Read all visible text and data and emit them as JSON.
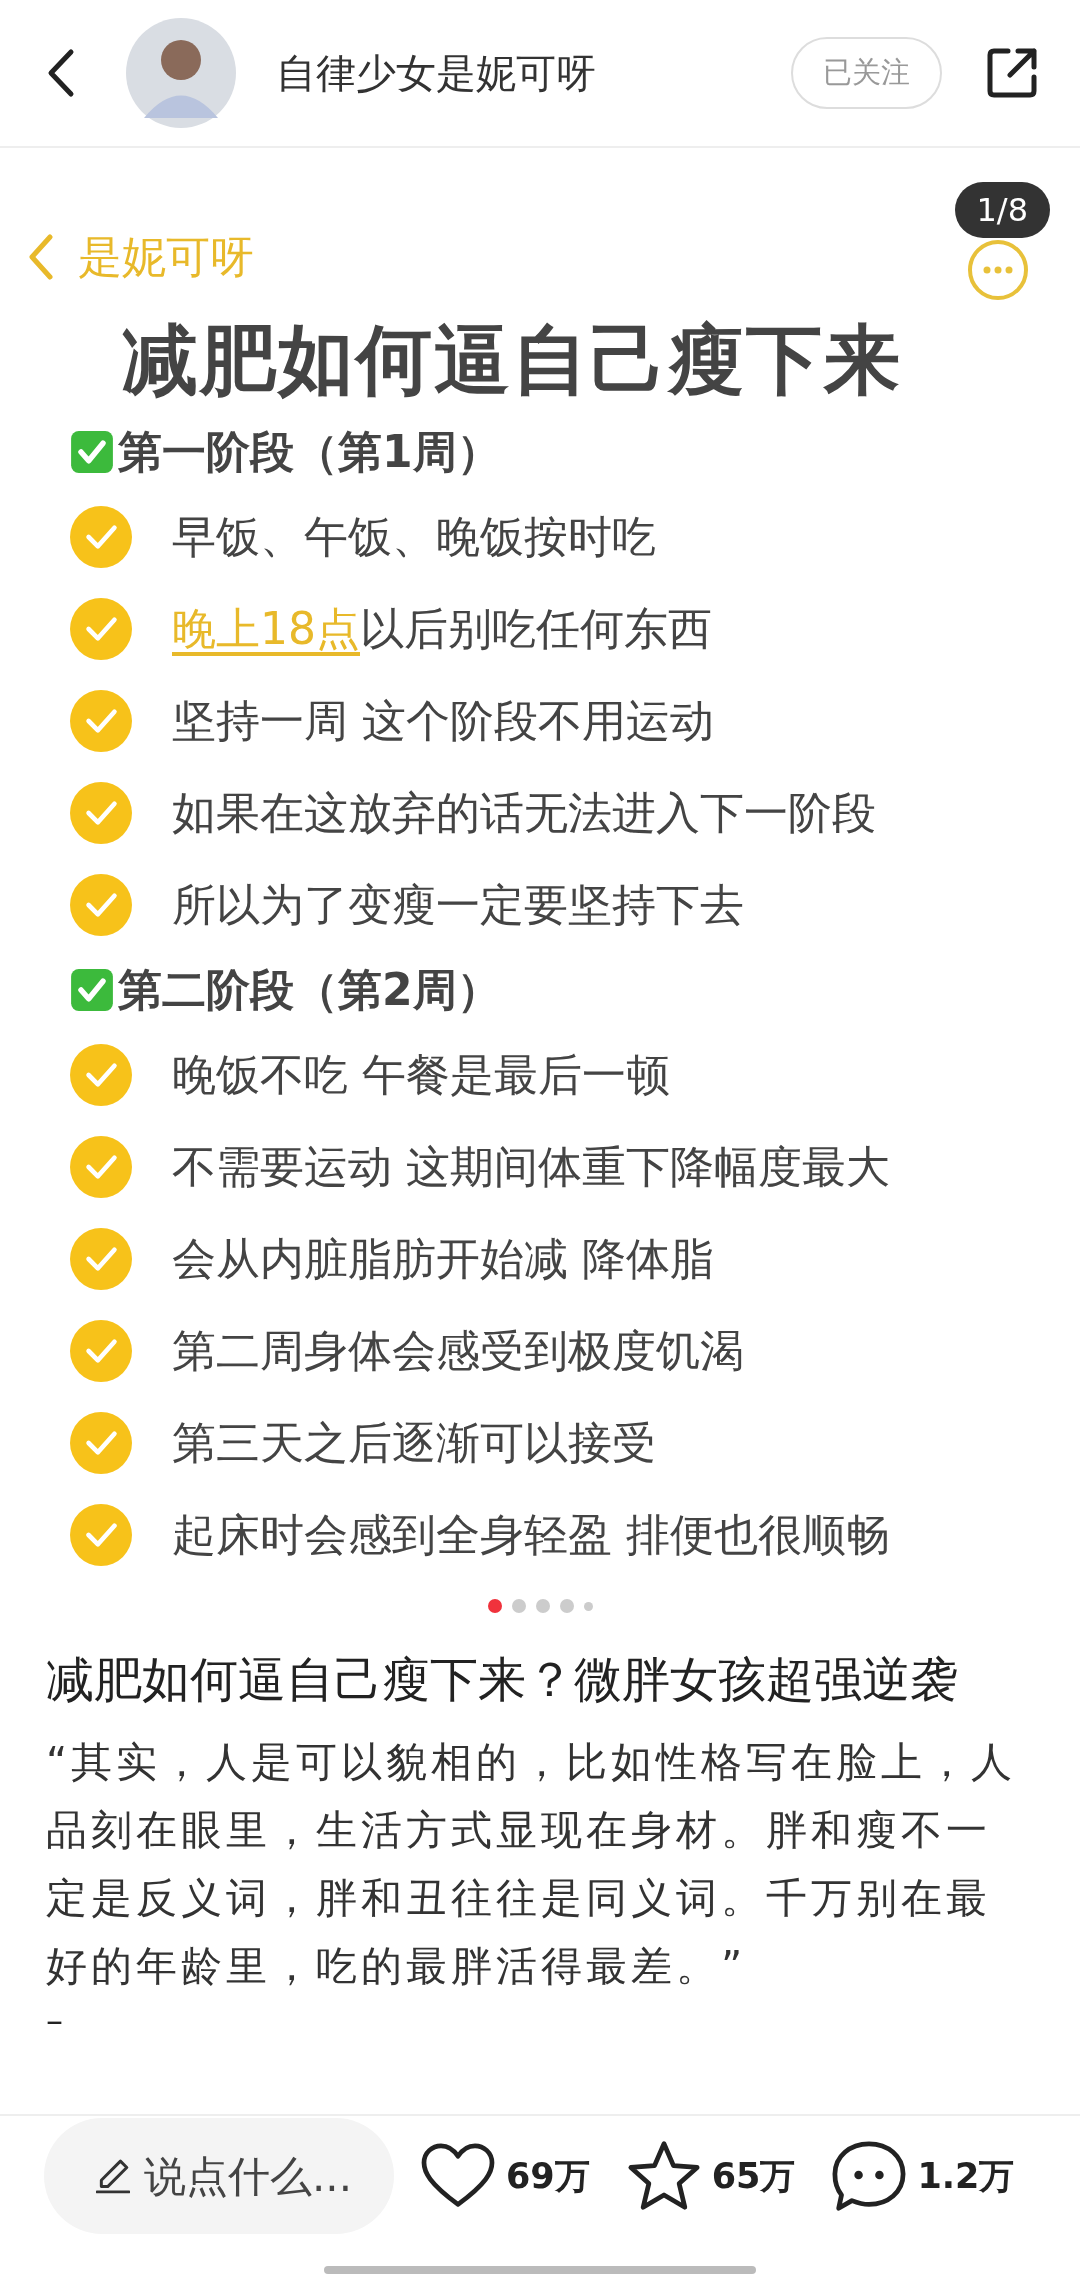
{
  "header": {
    "author": "自律少女是妮可呀",
    "follow_button": "已关注",
    "followed": true
  },
  "post_image": {
    "counter": "1/8",
    "back_label": "是妮可呀",
    "title": "减肥如何逼自己瘦下来",
    "sections": [
      {
        "heading": "第一阶段（第1周）",
        "items": [
          {
            "text": "早饭、午饭、晚饭按时吃"
          },
          {
            "highlight": "晚上18点",
            "text": "以后别吃任何东西"
          },
          {
            "text": "坚持一周 这个阶段不用运动"
          },
          {
            "text": "如果在这放弃的话无法进入下一阶段"
          },
          {
            "text": "所以为了变瘦一定要坚持下去"
          }
        ]
      },
      {
        "heading": "第二阶段（第2周）",
        "items": [
          {
            "text": "晚饭不吃 午餐是最后一顿"
          },
          {
            "text": "不需要运动 这期间体重下降幅度最大"
          },
          {
            "text": "会从内脏脂肪开始减  降体脂"
          },
          {
            "text": "第二周身体会感受到极度饥渴"
          },
          {
            "text": "第三天之后逐渐可以接受"
          },
          {
            "text": "起床时会感到全身轻盈 排便也很顺畅"
          }
        ]
      }
    ]
  },
  "page_dots": [
    {
      "selected": true
    },
    {
      "selected": false
    },
    {
      "selected": false
    },
    {
      "selected": false
    },
    {
      "selected": false
    }
  ],
  "post": {
    "title": "减肥如何逼自己瘦下来？微胖女孩超强逆袭",
    "body": "“其实，人是可以貌相的，比如性格写在脸上，人品刻在眼里，生活方式显现在身材。胖和瘦不一定是反义词，胖和丑往往是同义词。千万别在最好的年龄里，吃的最胖活得最差。”",
    "separator": "–"
  },
  "bottom_bar": {
    "comment_field": {
      "placeholder": "说点什么..."
    },
    "likes": "69万",
    "favorites": "65万",
    "comments": "1.2万"
  }
}
